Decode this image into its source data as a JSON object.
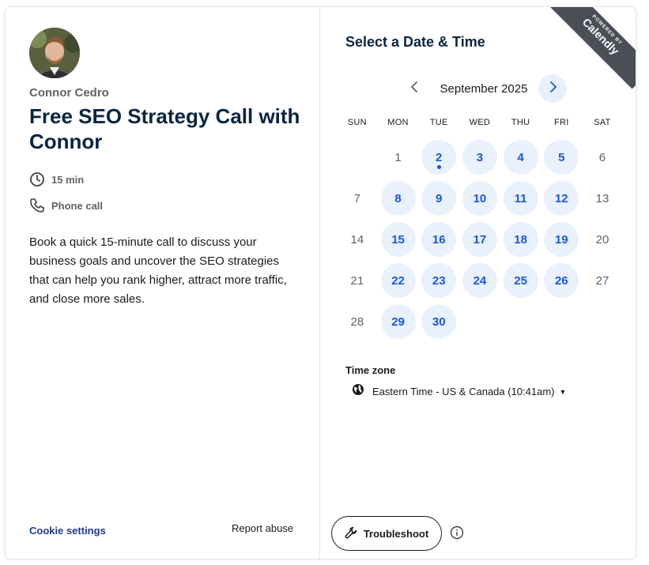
{
  "host": {
    "name": "Connor Cedro",
    "avatar_icon": "profile-photo"
  },
  "event": {
    "title": "Free SEO Strategy Call with Connor",
    "duration": "15 min",
    "duration_icon": "clock-icon",
    "location": "Phone call",
    "location_icon": "phone-icon",
    "description": "Book a quick 15-minute call to discuss your business goals and uncover the SEO strategies that can help you rank higher, attract more traffic, and close more sales."
  },
  "footer": {
    "cookie_settings": "Cookie settings",
    "report_abuse": "Report abuse"
  },
  "scheduler": {
    "title": "Select a Date & Time",
    "month_label": "September 2025",
    "prev_icon": "chevron-left-icon",
    "next_icon": "chevron-right-icon",
    "weekdays": [
      "SUN",
      "MON",
      "TUE",
      "WED",
      "THU",
      "FRI",
      "SAT"
    ],
    "weeks": [
      [
        {
          "d": ""
        },
        {
          "d": "1"
        },
        {
          "d": "2",
          "avail": true,
          "today": true
        },
        {
          "d": "3",
          "avail": true
        },
        {
          "d": "4",
          "avail": true
        },
        {
          "d": "5",
          "avail": true
        },
        {
          "d": "6"
        }
      ],
      [
        {
          "d": "7"
        },
        {
          "d": "8",
          "avail": true
        },
        {
          "d": "9",
          "avail": true
        },
        {
          "d": "10",
          "avail": true
        },
        {
          "d": "11",
          "avail": true
        },
        {
          "d": "12",
          "avail": true
        },
        {
          "d": "13"
        }
      ],
      [
        {
          "d": "14"
        },
        {
          "d": "15",
          "avail": true
        },
        {
          "d": "16",
          "avail": true
        },
        {
          "d": "17",
          "avail": true
        },
        {
          "d": "18",
          "avail": true
        },
        {
          "d": "19",
          "avail": true
        },
        {
          "d": "20"
        }
      ],
      [
        {
          "d": "21"
        },
        {
          "d": "22",
          "avail": true
        },
        {
          "d": "23",
          "avail": true
        },
        {
          "d": "24",
          "avail": true
        },
        {
          "d": "25",
          "avail": true
        },
        {
          "d": "26",
          "avail": true
        },
        {
          "d": "27"
        }
      ],
      [
        {
          "d": "28"
        },
        {
          "d": "29",
          "avail": true
        },
        {
          "d": "30",
          "avail": true
        },
        {
          "d": ""
        },
        {
          "d": ""
        },
        {
          "d": ""
        },
        {
          "d": ""
        }
      ]
    ],
    "timezone_label": "Time zone",
    "timezone_value": "Eastern Time - US & Canada (10:41am)",
    "timezone_icon": "globe-icon",
    "troubleshoot_label": "Troubleshoot",
    "troubleshoot_icon": "wrench-icon",
    "info_icon": "info-icon"
  },
  "badge": {
    "small_text": "POWERED BY",
    "brand": "Calendly"
  },
  "colors": {
    "accent": "#1a56db",
    "available_bg": "#e9f1fd",
    "title": "#0a2540",
    "ribbon": "#4a4f57"
  }
}
